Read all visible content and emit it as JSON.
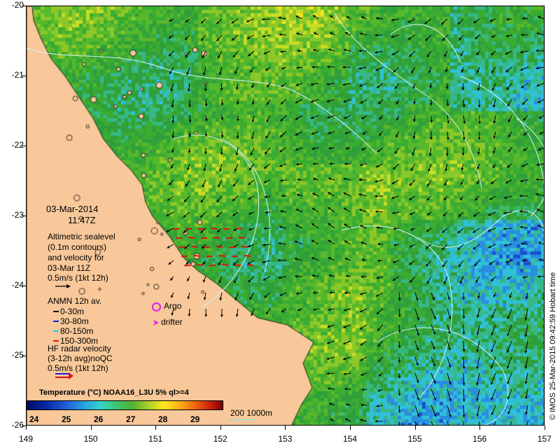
{
  "map": {
    "lat_labels": [
      "-20",
      "-21",
      "-22",
      "-23",
      "-24",
      "-25",
      "-26"
    ],
    "lon_labels": [
      "149",
      "150",
      "151",
      "152",
      "153",
      "154",
      "155",
      "156",
      "157"
    ]
  },
  "legend": {
    "date": "03-Mar-2014",
    "time": "11:47Z",
    "altimetry": [
      "Altimetric sealevel",
      "(0.1m contours)",
      "and velocity for",
      "03-Mar 11Z",
      "0.5m/s (1kt 12h)"
    ],
    "anmn_title": "ANMN 12h av.",
    "anmn_items": [
      {
        "label": "0-30m",
        "color": "#000000"
      },
      {
        "label": "30-80m",
        "color": "#1020e0"
      },
      {
        "label": "80-150m",
        "color": "#20d0e0"
      },
      {
        "label": "150-300m",
        "color": "#e01010"
      }
    ],
    "argo": "Argo",
    "drifter": "drifter",
    "hf_radar": [
      "HF radar velocity",
      "(3-12h avg)noQC",
      "0.5m/s (1kt 12h)"
    ],
    "bathy": "200  1000m"
  },
  "colorbar": {
    "title": "Temperature (°C) NOAA16_L3U 5% ql>=4",
    "ticks": [
      "24",
      "25",
      "26",
      "27",
      "28",
      "29"
    ]
  },
  "credit": "© IMOS 25-Mar-2015 09:42:59 Hobart time",
  "colors": {
    "land": "#f8c89a",
    "argo": "#e020e0",
    "hf_red": "#e01010"
  }
}
